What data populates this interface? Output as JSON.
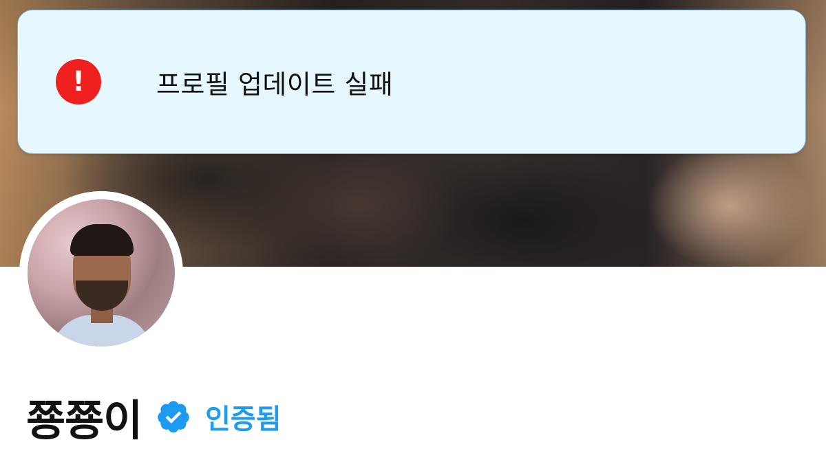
{
  "toast": {
    "icon": "error-exclamation-icon",
    "icon_glyph": "!",
    "message": "프로필 업데이트 실패",
    "colors": {
      "background": "#e6f7fe",
      "icon": "#ee2020"
    }
  },
  "profile": {
    "banner": "cover-photo",
    "avatar": "profile-photo",
    "display_name": "쭁쭁이",
    "verified_icon": "verified-badge-icon",
    "verified_label": "인증됨",
    "colors": {
      "verified": "#1d9bf0"
    }
  }
}
